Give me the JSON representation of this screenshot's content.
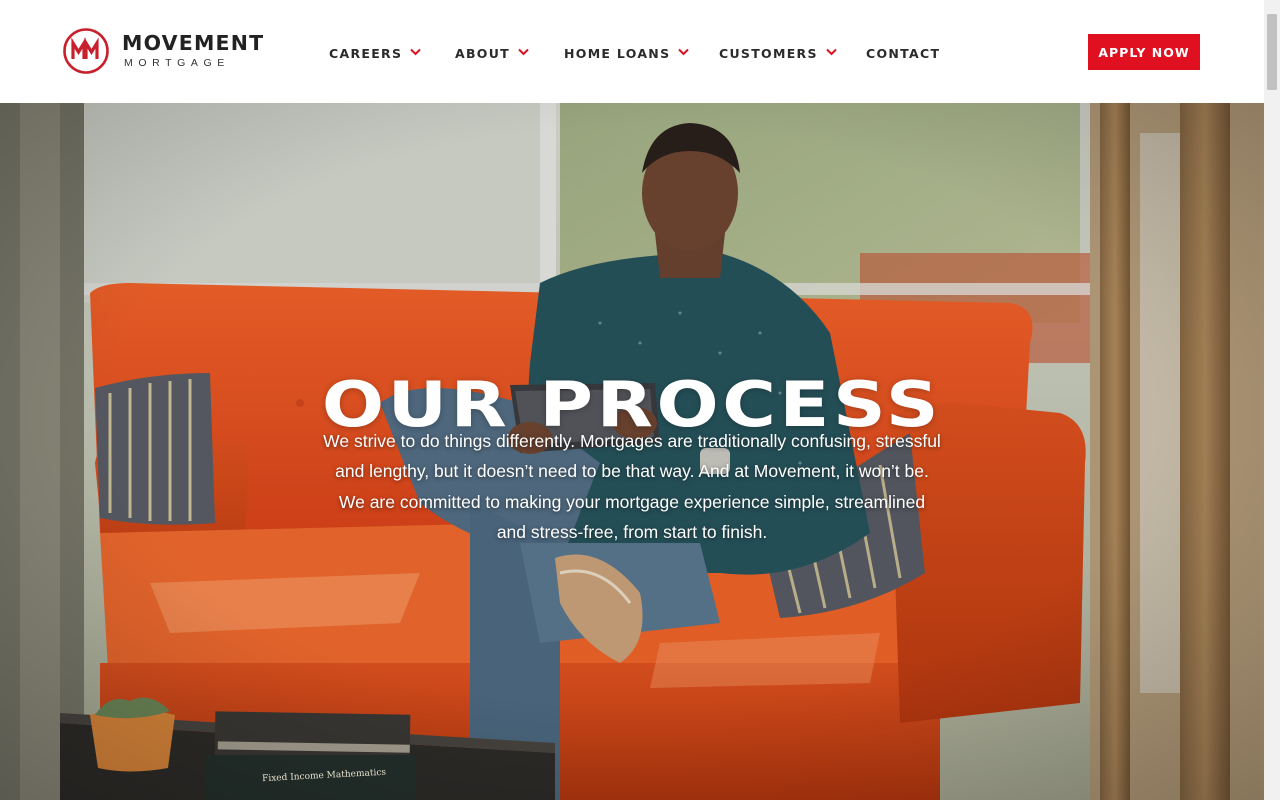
{
  "brand": {
    "name": "MOVEMENT",
    "subtitle": "MORTGAGE",
    "accent_color": "#e11020"
  },
  "nav": {
    "items": [
      {
        "label": "CAREERS",
        "has_dropdown": true,
        "icon": "chevron-down-icon"
      },
      {
        "label": "ABOUT",
        "has_dropdown": true,
        "icon": "chevron-down-icon"
      },
      {
        "label": "HOME LOANS",
        "has_dropdown": true,
        "icon": "chevron-down-icon"
      },
      {
        "label": "CUSTOMERS",
        "has_dropdown": true,
        "icon": "chevron-down-icon"
      },
      {
        "label": "CONTACT",
        "has_dropdown": false
      }
    ],
    "cta_label": "APPLY NOW"
  },
  "hero": {
    "title": "OUR PROCESS",
    "body": "We strive to do things differently. Mortgages are traditionally confusing, stressful and lengthy, but it doesn’t need to be that way. And at Movement, it won’t be. We are committed to making your mortgage experience simple, streamlined and stress-free, from start to finish.",
    "book_titles": [
      "Fixed Income Mathematics"
    ]
  }
}
